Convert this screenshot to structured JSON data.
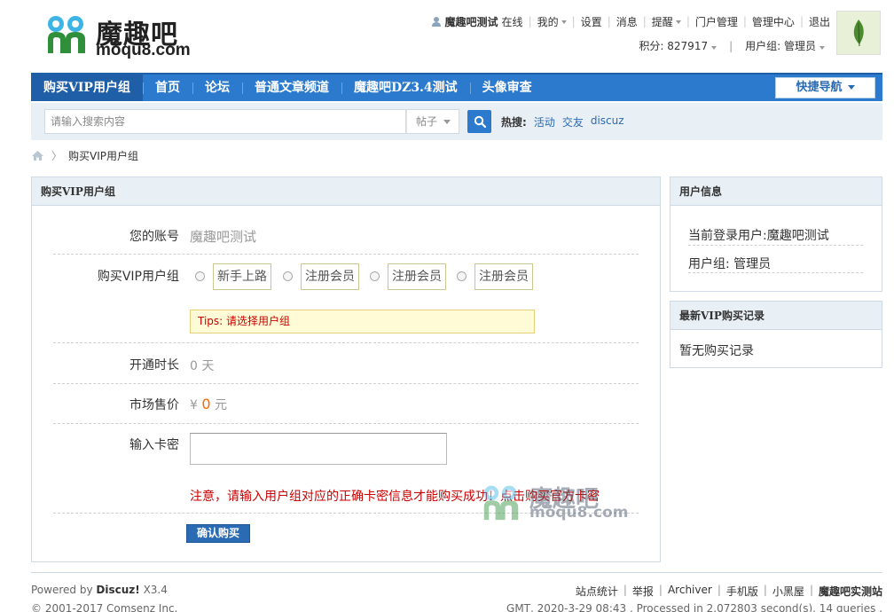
{
  "header": {
    "logo_cn": "魔趣吧",
    "logo_en": "moqu8.com",
    "topbar": {
      "username": "魔趣吧测试",
      "online": "在线",
      "my": "我的",
      "settings": "设置",
      "messages": "消息",
      "reminder": "提醒",
      "portal_admin": "门户管理",
      "admin_center": "管理中心",
      "logout": "退出"
    },
    "credits_label": "积分: 827917",
    "usergroup_label": "用户组: 管理员"
  },
  "nav": {
    "items": [
      {
        "label": "购买VIP用户组"
      },
      {
        "label": "首页"
      },
      {
        "label": "论坛"
      },
      {
        "label": "普通文章频道"
      },
      {
        "label": "魔趣吧DZ3.4测试"
      },
      {
        "label": "头像审查"
      }
    ],
    "quick_nav": "快捷导航"
  },
  "search": {
    "placeholder": "请输入搜索内容",
    "type": "帖子",
    "hot_label": "热搜:",
    "hot_words": [
      "活动",
      "交友",
      "discuz"
    ]
  },
  "breadcrumb": {
    "current": "购买VIP用户组"
  },
  "main": {
    "title": "购买VIP用户组",
    "account_label": "您的账号",
    "account_value": "魔趣吧测试",
    "group_label": "购买VIP用户组",
    "group_options": [
      "新手上路",
      "注册会员",
      "注册会员",
      "注册会员"
    ],
    "tips": "Tips: 请选择用户组",
    "duration_label": "开通时长",
    "duration_value": "0 天",
    "price_label": "市场售价",
    "price_currency": "¥",
    "price_value": "0",
    "price_unit": "元",
    "card_label": "输入卡密",
    "notice": "注意，请输入用户组对应的正确卡密信息才能购买成功！点击购买官方卡密",
    "confirm": "确认购买"
  },
  "watermark": {
    "cn": "魔趣吧",
    "en": "moqu8.com"
  },
  "sidebar": {
    "userinfo_title": "用户信息",
    "current_user": "当前登录用户:魔趣吧测试",
    "user_group": "用户组: 管理员",
    "records_title": "最新VIP购买记录",
    "records_empty": "暂无购买记录"
  },
  "footer": {
    "powered_prefix": "Powered by",
    "powered_brand": "Discuz!",
    "powered_version": "X3.4",
    "copyright": "© 2001-2017 Comsenz Inc.",
    "links": [
      "站点统计",
      "举报",
      "Archiver",
      "手机版",
      "小黑屋",
      "魔趣吧实测站"
    ],
    "gmt": "GMT, 2020-3-29 08:43 , Processed in 2.072803 second(s), 14 queries ."
  },
  "colors": {
    "nav_bg": "#2b7acd",
    "panel_head_bg": "#e8eff5",
    "tips_bg": "#fefbd6",
    "notice": "#cc0000",
    "price": "#ff6600"
  }
}
